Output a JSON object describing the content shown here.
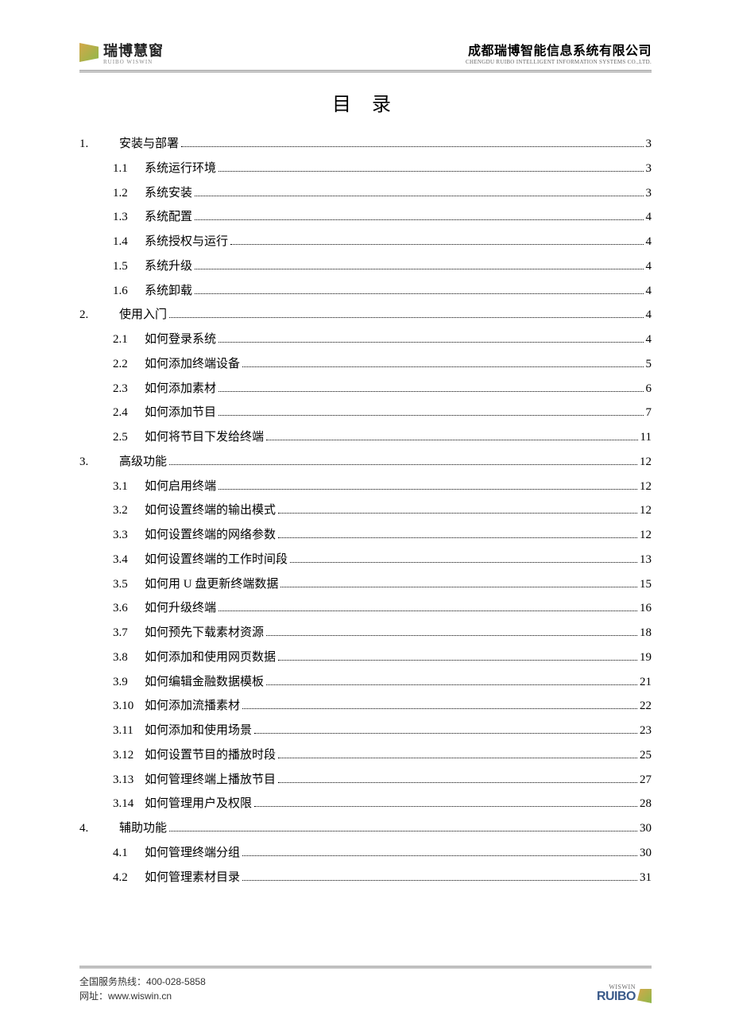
{
  "header": {
    "logo_cn": "瑞博慧窗",
    "logo_en": "RUIBO WISWIN",
    "company_cn": "成都瑞博智能信息系统有限公司",
    "company_en": "CHENGDU RUIBO INTELLIGENT INFORMATION SYSTEMS CO.,LTD."
  },
  "toc_title": "目 录",
  "toc": [
    {
      "num": "1.",
      "text": "安装与部署",
      "page": "3",
      "level": 1
    },
    {
      "num": "1.1",
      "text": "系统运行环境",
      "page": "3",
      "level": 2
    },
    {
      "num": "1.2",
      "text": "系统安装",
      "page": "3",
      "level": 2
    },
    {
      "num": "1.3",
      "text": "系统配置",
      "page": "4",
      "level": 2
    },
    {
      "num": "1.4",
      "text": "系统授权与运行",
      "page": "4",
      "level": 2
    },
    {
      "num": "1.5",
      "text": "系统升级",
      "page": "4",
      "level": 2
    },
    {
      "num": "1.6",
      "text": "系统卸载",
      "page": "4",
      "level": 2
    },
    {
      "num": "2.",
      "text": "使用入门",
      "page": "4",
      "level": 1
    },
    {
      "num": "2.1",
      "text": "如何登录系统",
      "page": "4",
      "level": 2
    },
    {
      "num": "2.2",
      "text": "如何添加终端设备",
      "page": "5",
      "level": 2
    },
    {
      "num": "2.3",
      "text": "如何添加素材",
      "page": "6",
      "level": 2
    },
    {
      "num": "2.4",
      "text": "如何添加节目",
      "page": "7",
      "level": 2
    },
    {
      "num": "2.5",
      "text": "如何将节目下发给终端",
      "page": "11",
      "level": 2
    },
    {
      "num": "3.",
      "text": "高级功能",
      "page": "12",
      "level": 1
    },
    {
      "num": "3.1",
      "text": "如何启用终端",
      "page": "12",
      "level": 2
    },
    {
      "num": "3.2",
      "text": "如何设置终端的输出模式",
      "page": "12",
      "level": 2
    },
    {
      "num": "3.3",
      "text": "如何设置终端的网络参数",
      "page": "12",
      "level": 2
    },
    {
      "num": "3.4",
      "text": "如何设置终端的工作时间段",
      "page": "13",
      "level": 2
    },
    {
      "num": "3.5",
      "text": "如何用 U 盘更新终端数据",
      "page": "15",
      "level": 2
    },
    {
      "num": "3.6",
      "text": "如何升级终端",
      "page": "16",
      "level": 2
    },
    {
      "num": "3.7",
      "text": "如何预先下载素材资源",
      "page": "18",
      "level": 2
    },
    {
      "num": "3.8",
      "text": "如何添加和使用网页数据",
      "page": "19",
      "level": 2
    },
    {
      "num": "3.9",
      "text": "如何编辑金融数据模板",
      "page": "21",
      "level": 2
    },
    {
      "num": "3.10",
      "text": "如何添加流播素材",
      "page": "22",
      "level": 2
    },
    {
      "num": "3.11",
      "text": "如何添加和使用场景",
      "page": "23",
      "level": 2
    },
    {
      "num": "3.12",
      "text": "如何设置节目的播放时段",
      "page": "25",
      "level": 2
    },
    {
      "num": "3.13",
      "text": "如何管理终端上播放节目",
      "page": "27",
      "level": 2
    },
    {
      "num": "3.14",
      "text": "如何管理用户及权限",
      "page": "28",
      "level": 2
    },
    {
      "num": "4.",
      "text": "辅助功能",
      "page": "30",
      "level": 1
    },
    {
      "num": "4.1",
      "text": "如何管理终端分组",
      "page": "30",
      "level": 2
    },
    {
      "num": "4.2",
      "text": "如何管理素材目录",
      "page": "31",
      "level": 2
    }
  ],
  "footer": {
    "hotline_label": "全国服务热线：",
    "hotline": "400-028-5858",
    "website_label": "网址：",
    "website": "www.wiswin.cn",
    "logo_top": "WISWIN",
    "logo_bottom": "RUIBO"
  }
}
